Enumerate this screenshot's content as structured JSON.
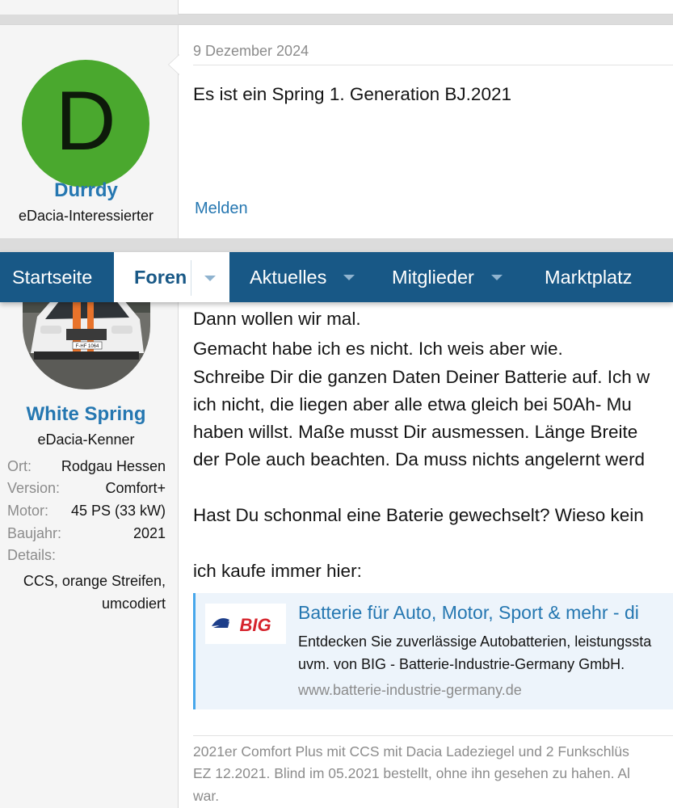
{
  "post1": {
    "avatar_letter": "D",
    "username": "Durrdy",
    "user_title": "eDacia-Interessierter",
    "date": "9 Dezember 2024",
    "message": "Es ist ein Spring 1. Generation BJ.2021",
    "report_label": "Melden"
  },
  "nav": {
    "items": [
      {
        "label": "Startseite"
      },
      {
        "label": "Foren"
      },
      {
        "label": "Aktuelles"
      },
      {
        "label": "Mitglieder"
      },
      {
        "label": "Marktplatz"
      }
    ]
  },
  "post2": {
    "username": "White Spring",
    "user_title": "eDacia-Kenner",
    "avatar_plate": "F-HF 1064",
    "info": [
      {
        "key": "Ort:",
        "value": "Rodgau Hessen"
      },
      {
        "key": "Version:",
        "value": "Comfort+"
      },
      {
        "key": "Motor:",
        "value": "45 PS (33 kW)"
      },
      {
        "key": "Baujahr:",
        "value": "2021"
      },
      {
        "key": "Details:",
        "value": ""
      }
    ],
    "details_lines": [
      "CCS, orange Streifen,",
      "umcodiert"
    ],
    "lines": [
      "Dann wollen wir mal.",
      "Gemacht habe ich es nicht. Ich weis aber wie.",
      "Schreibe Dir die ganzen Daten Deiner Batterie auf. Ich w",
      "ich nicht, die liegen aber alle etwa gleich bei 50Ah- Mu",
      "haben willst. Maße musst Dir ausmessen. Länge Breite",
      "der Pole auch beachten. Da muss nichts angelernt werd",
      "Hast Du schonmal eine Baterie gewechselt? Wieso kein",
      "ich kaufe immer hier:"
    ],
    "preview": {
      "logo_text": "BIG",
      "title": "Batterie für Auto, Motor, Sport & mehr - di",
      "desc_lines": [
        "Entdecken Sie zuverlässige Autobatterien, leistungssta",
        "uvm. von BIG - Batterie-Industrie-Germany GmbH."
      ],
      "url": "www.batterie-industrie-germany.de"
    },
    "signature_lines": [
      "2021er Comfort Plus mit CCS mit Dacia Ladeziegel und 2 Funkschlüs",
      "EZ 12.2021. Blind im 05.2021 bestellt, ohne ihn gesehen zu hahen. Al",
      "war."
    ]
  }
}
